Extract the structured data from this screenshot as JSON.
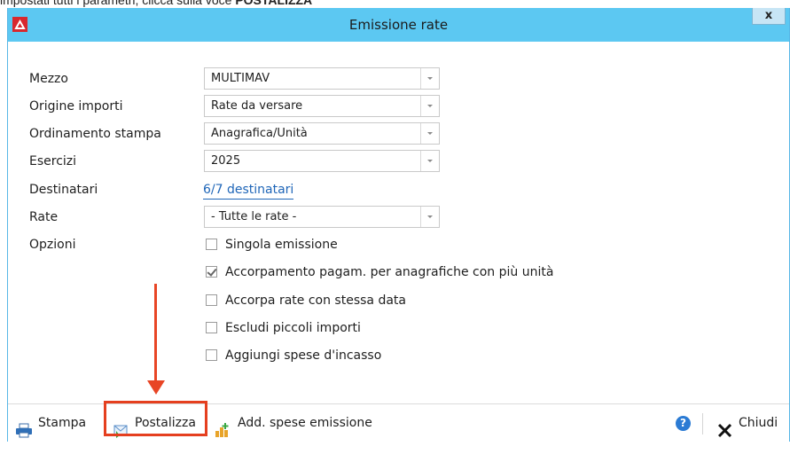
{
  "caption": {
    "text_before": "impostati tutti i parametri, clicca sulla voce ",
    "text_bold": "POSTALIZZA"
  },
  "window": {
    "title": "Emissione rate",
    "close_label": "x"
  },
  "form": {
    "mezzo": {
      "label": "Mezzo",
      "value": "MULTIMAV"
    },
    "origine": {
      "label": "Origine importi",
      "value": "Rate da versare"
    },
    "ordinamento": {
      "label": "Ordinamento stampa",
      "value": "Anagrafica/Unità"
    },
    "esercizi": {
      "label": "Esercizi",
      "value": "2025"
    },
    "destinatari": {
      "label": "Destinatari",
      "value": "6/7 destinatari"
    },
    "rate": {
      "label": "Rate",
      "value": "- Tutte le rate -"
    },
    "opzioni": {
      "label": "Opzioni",
      "items": [
        {
          "label": "Singola emissione",
          "checked": false
        },
        {
          "label": "Accorpamento pagam. per anagrafiche con più unità",
          "checked": true
        },
        {
          "label": "Accorpa rate con stessa data",
          "checked": false
        },
        {
          "label": "Escludi piccoli importi",
          "checked": false
        },
        {
          "label": "Aggiungi spese d'incasso",
          "checked": false
        }
      ]
    }
  },
  "footer": {
    "stampa": "Stampa",
    "postalizza": "Postalizza",
    "add_spese": "Add. spese emissione",
    "help": "?",
    "chiudi": "Chiudi"
  },
  "colors": {
    "titlebar": "#5cc8f2",
    "link": "#1f66b8",
    "highlight": "#e53f1f"
  },
  "icons": {
    "app": "app-logo-icon",
    "stampa": "printer-icon",
    "postalizza": "mail-send-icon",
    "add_spese": "add-coins-icon",
    "help": "help-icon",
    "chiudi": "close-x-icon"
  }
}
